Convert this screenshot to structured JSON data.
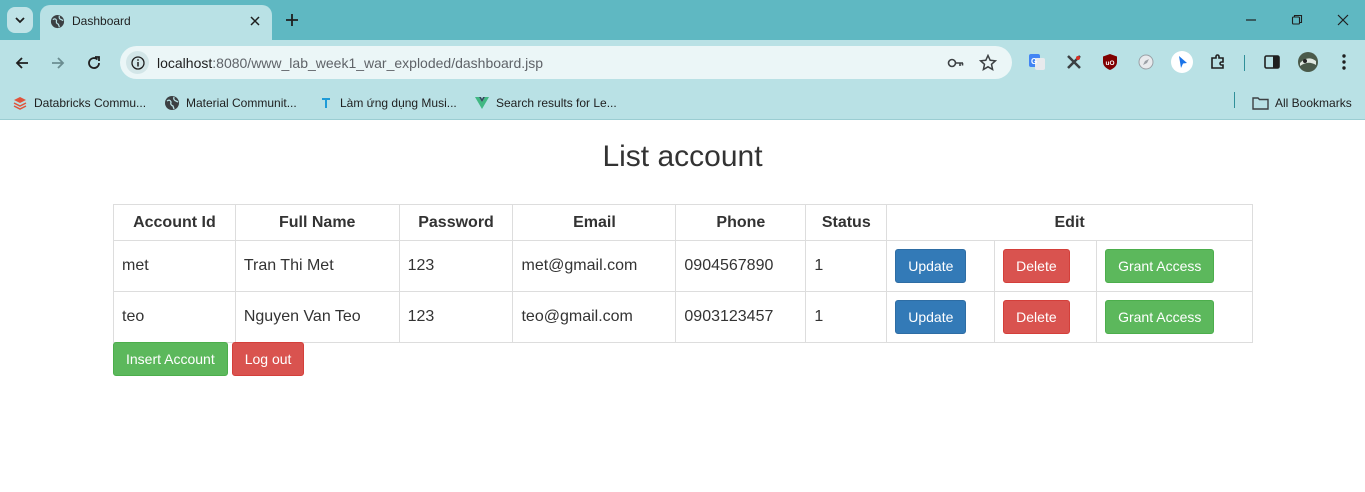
{
  "browser": {
    "tab_title": "Dashboard",
    "url_host": "localhost",
    "url_rest": ":8080/www_lab_week1_war_exploded/dashboard.jsp",
    "bookmarks": [
      {
        "label": "Databricks Commu...",
        "icon": "databricks-icon"
      },
      {
        "label": "Material Communit...",
        "icon": "globe-icon"
      },
      {
        "label": "Làm ứng dụng Musi...",
        "icon": "flutter-icon"
      },
      {
        "label": "Search results for Le...",
        "icon": "vue-icon"
      }
    ],
    "all_bookmarks_label": "All Bookmarks"
  },
  "page": {
    "title": "List account",
    "table": {
      "headers": [
        "Account Id",
        "Full Name",
        "Password",
        "Email",
        "Phone",
        "Status",
        "Edit"
      ],
      "rows": [
        {
          "account_id": "met",
          "full_name": "Tran Thi Met",
          "password": "123",
          "email": "met@gmail.com",
          "phone": "0904567890",
          "status": "1"
        },
        {
          "account_id": "teo",
          "full_name": "Nguyen Van Teo",
          "password": "123",
          "email": "teo@gmail.com",
          "phone": "0903123457",
          "status": "1"
        }
      ],
      "row_actions": {
        "update": "Update",
        "delete": "Delete",
        "grant": "Grant Access"
      }
    },
    "actions": {
      "insert": "Insert Account",
      "logout": "Log out"
    }
  },
  "colors": {
    "primary": "#337ab7",
    "danger": "#d9534f",
    "success": "#5cb85c",
    "chrome": "#5fb8c2",
    "chrome_light": "#b9e1e5"
  }
}
